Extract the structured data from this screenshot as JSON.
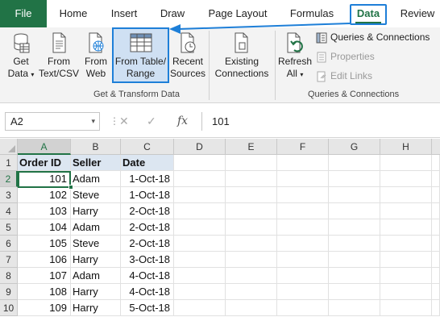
{
  "tabs": [
    {
      "label": "File"
    },
    {
      "label": "Home"
    },
    {
      "label": "Insert"
    },
    {
      "label": "Draw"
    },
    {
      "label": "Page Layout"
    },
    {
      "label": "Formulas"
    },
    {
      "label": "Data"
    },
    {
      "label": "Review"
    }
  ],
  "ribbon": {
    "get_data": {
      "line1": "Get",
      "line2": "Data"
    },
    "from_text": {
      "line1": "From",
      "line2": "Text/CSV"
    },
    "from_web": {
      "line1": "From",
      "line2": "Web"
    },
    "from_table": {
      "line1": "From Table/",
      "line2": "Range"
    },
    "recent": {
      "line1": "Recent",
      "line2": "Sources"
    },
    "existing": {
      "line1": "Existing",
      "line2": "Connections"
    },
    "refresh": {
      "line1": "Refresh",
      "line2": "All"
    },
    "group1_label": "Get & Transform Data",
    "group2_label": "Queries & Connections",
    "queries_connections": "Queries & Connections",
    "properties": "Properties",
    "edit_links": "Edit Links"
  },
  "formula_bar": {
    "name_box": "A2",
    "fx": "fx",
    "value": "101"
  },
  "columns": [
    "A",
    "B",
    "C",
    "D",
    "E",
    "F",
    "G",
    "H"
  ],
  "rows": [
    "1",
    "2",
    "3",
    "4",
    "5",
    "6",
    "7",
    "8",
    "9",
    "10"
  ],
  "table": {
    "headers": [
      "Order ID",
      "Seller",
      "Date"
    ],
    "rows": [
      [
        "101",
        "Adam",
        "1-Oct-18"
      ],
      [
        "102",
        "Steve",
        "1-Oct-18"
      ],
      [
        "103",
        "Harry",
        "2-Oct-18"
      ],
      [
        "104",
        "Adam",
        "2-Oct-18"
      ],
      [
        "105",
        "Steve",
        "2-Oct-18"
      ],
      [
        "106",
        "Harry",
        "3-Oct-18"
      ],
      [
        "107",
        "Adam",
        "4-Oct-18"
      ],
      [
        "108",
        "Harry",
        "4-Oct-18"
      ],
      [
        "109",
        "Harry",
        "5-Oct-18"
      ]
    ]
  },
  "colors": {
    "accent": "#217346",
    "highlight": "#1e7fd8"
  }
}
